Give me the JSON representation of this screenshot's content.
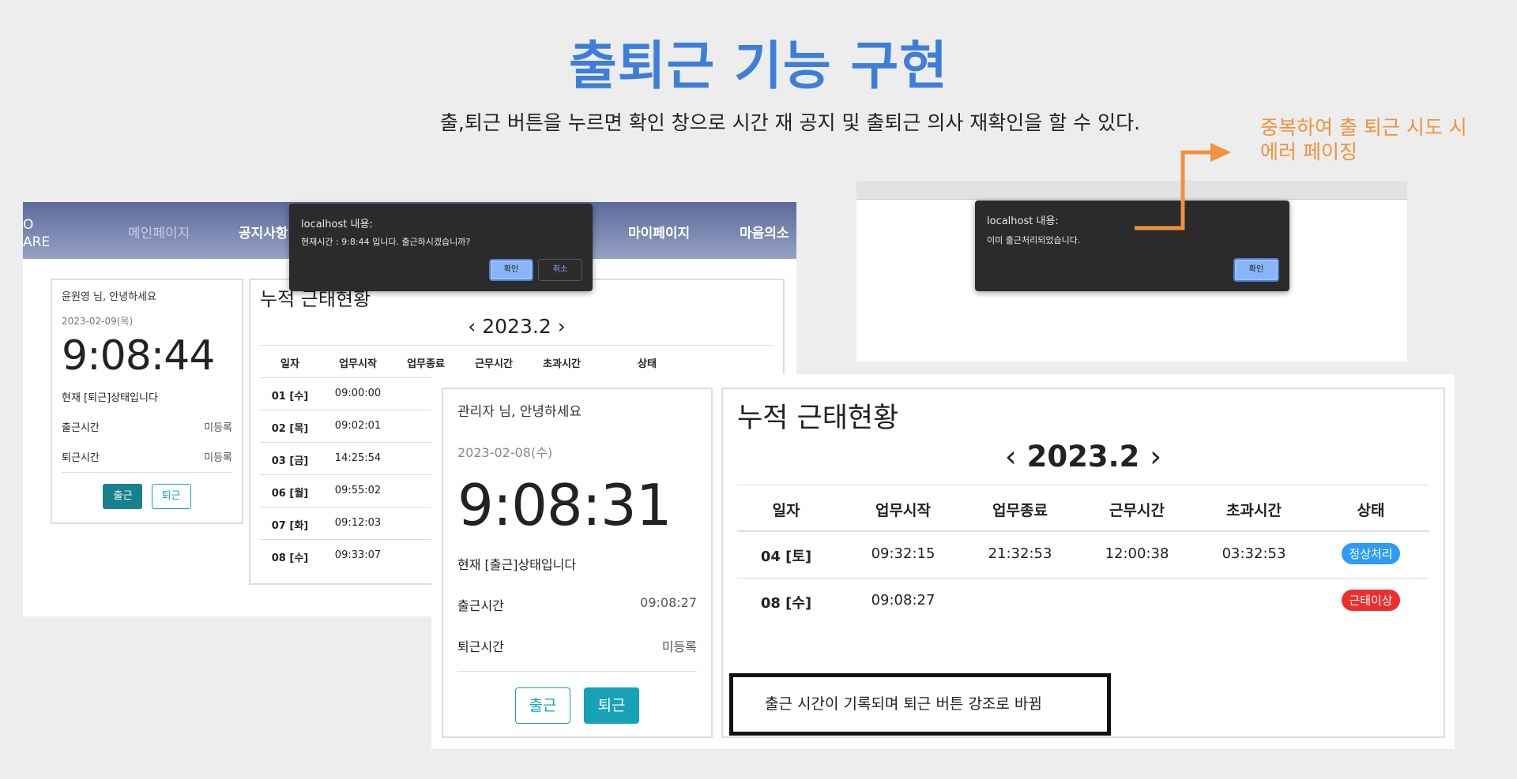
{
  "slide": {
    "title": "출퇴근 기능 구현",
    "subtitle": "출,퇴근 버튼을 누르면 확인 창으로 시간 재 공지 및 출퇴근 의사 재확인을 할 수 있다.",
    "annotation_line1": "중복하여 출 퇴근 시도 시",
    "annotation_line2": "에러 페이징",
    "annotation_color": "#f0923e",
    "title_color": "#3d7fd8"
  },
  "shot1": {
    "logo_line1": "O",
    "logo_line2": "ARE",
    "nav": [
      "메인페이지",
      "공지사항",
      "마이페이지",
      "마음의소"
    ],
    "card": {
      "greeting": "윤원영 님, 안녕하세요",
      "date": "2023-02-09(목)",
      "clock": "9:08:44",
      "state": "현재 [퇴근]상태입니다",
      "in_label": "출근시간",
      "in_value": "미등록",
      "out_label": "퇴근시간",
      "out_value": "미등록",
      "btn_in": "출근",
      "btn_out": "퇴근"
    },
    "grid": {
      "title": "누적 근태현황",
      "month": "2023.2",
      "prev_icon": "chevron-left-icon",
      "next_icon": "chevron-right-icon",
      "headers": [
        "일자",
        "업무시작",
        "업무종료",
        "근무시간",
        "초과시간",
        "상태"
      ],
      "rows": [
        {
          "day": "01 [수]",
          "start": "09:00:00"
        },
        {
          "day": "02 [목]",
          "start": "09:02:01"
        },
        {
          "day": "03 [금]",
          "start": "14:25:54"
        },
        {
          "day": "06 [월]",
          "start": "09:55:02"
        },
        {
          "day": "07 [화]",
          "start": "09:12:03"
        },
        {
          "day": "08 [수]",
          "start": "09:33:07"
        }
      ]
    },
    "alert": {
      "title": "localhost 내용:",
      "message": "현재시간 : 9:8:44 입니다. 출근하시겠습니까?",
      "ok": "확인",
      "cancel": "취소"
    }
  },
  "shot2": {
    "alert": {
      "title": "localhost 내용:",
      "message": "이미 출근처리되었습니다.",
      "ok": "확인"
    }
  },
  "shot3": {
    "card": {
      "greeting": "관리자 님, 안녕하세요",
      "date": "2023-02-08(수)",
      "clock": "9:08:31",
      "state": "현재 [출근]상태입니다",
      "in_label": "출근시간",
      "in_value": "09:08:27",
      "out_label": "퇴근시간",
      "out_value": "미등록",
      "btn_in": "출근",
      "btn_out": "퇴근"
    },
    "grid": {
      "title": "누적 근태현황",
      "month": "2023.2",
      "headers": [
        "일자",
        "업무시작",
        "업무종료",
        "근무시간",
        "초과시간",
        "상태"
      ],
      "rows": [
        {
          "day": "04 [토]",
          "start": "09:32:15",
          "end": "21:32:53",
          "work": "12:00:38",
          "over": "03:32:53",
          "status": "정상처리",
          "status_color": "#2e9cf3"
        },
        {
          "day": "08 [수]",
          "start": "09:08:27",
          "end": "",
          "work": "",
          "over": "",
          "status": "근태이상",
          "status_color": "#ee2e2e"
        }
      ]
    },
    "callout": "출근 시간이 기록되며 퇴근 버튼 강조로 바뀜"
  }
}
